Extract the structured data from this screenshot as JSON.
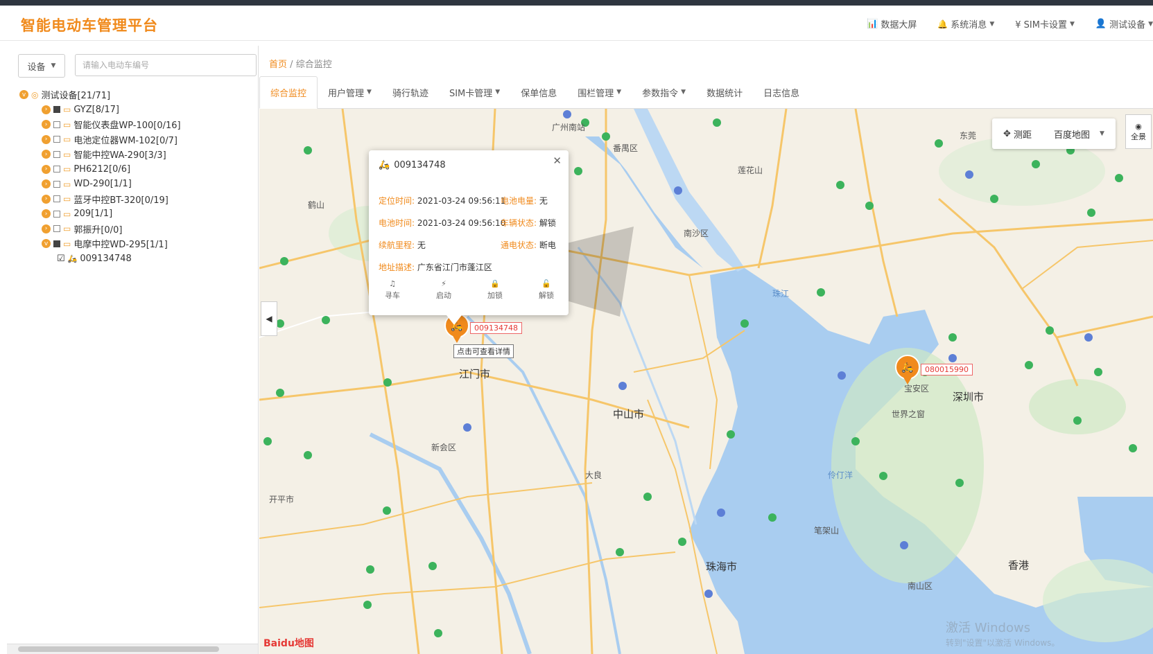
{
  "header": {
    "brand": "智能电动车管理平台",
    "nav": {
      "dashboard": "数据大屏",
      "messages": "系统消息",
      "sim": "¥ SIM卡设置",
      "user": "测试设备"
    }
  },
  "sidebar": {
    "filter_select": "设备",
    "search_placeholder": "请输入电动车编号",
    "tree": {
      "root": "测试设备[21/71]",
      "groups": [
        "GYZ[8/17]",
        "智能仪表盘WP-100[0/16]",
        "电池定位器WM-102[0/7]",
        "智能中控WA-290[3/3]",
        "PH6212[0/6]",
        "WD-290[1/1]",
        "蓝牙中控BT-320[0/19]",
        "209[1/1]",
        "郭振升[0/0]",
        "电摩中控WD-295[1/1]"
      ],
      "leaf": "009134748"
    }
  },
  "breadcrumb": {
    "home": "首页",
    "separator": "/",
    "current": "综合监控"
  },
  "tabs": [
    {
      "label": "综合监控",
      "dropdown": false
    },
    {
      "label": "用户管理",
      "dropdown": true
    },
    {
      "label": "骑行轨迹",
      "dropdown": false
    },
    {
      "label": "SIM卡管理",
      "dropdown": true
    },
    {
      "label": "保单信息",
      "dropdown": false
    },
    {
      "label": "围栏管理",
      "dropdown": true
    },
    {
      "label": "参数指令",
      "dropdown": true
    },
    {
      "label": "数据统计",
      "dropdown": false
    },
    {
      "label": "日志信息",
      "dropdown": false
    }
  ],
  "map": {
    "tools": {
      "measure": "测距",
      "map_type": "百度地图"
    },
    "fullview": "全景",
    "popup": {
      "device": "009134748",
      "fields": {
        "loc_time_label": "定位时间:",
        "loc_time": "2021-03-24 09:56:11",
        "battery_label": "电池电量:",
        "battery": "无",
        "power_time_label": "电池时间:",
        "power_time": "2021-03-24 09:56:10",
        "vehicle_status_label": "车辆状态:",
        "vehicle_status": "解锁",
        "mileage_label": "续航里程:",
        "mileage": "无",
        "power_status_label": "通电状态:",
        "power_status": "断电",
        "address_label": "地址描述:",
        "address": "广东省江门市蓬江区"
      },
      "actions": [
        "寻车",
        "启动",
        "加锁",
        "解锁"
      ]
    },
    "markers": [
      {
        "label": "009134748"
      },
      {
        "label": "080015990"
      }
    ],
    "marker_tip": "点击可查看详情",
    "places": {
      "jiangmen": "江门市",
      "zhongshan": "中山市",
      "zhuhai": "珠海市",
      "shenzhen": "深圳市",
      "hongkong": "香港",
      "nansha": "南沙区",
      "panyu": "番禺区",
      "dongguan": "东莞",
      "xinhui": "新会区",
      "heshan": "鹤山",
      "kaiping": "开平市",
      "baoan": "宝安区",
      "nanshan": "南山区",
      "lingdingyang": "伶仃洋",
      "zhujiang": "珠江",
      "lianhuashan": "莲花山",
      "daliang": "大良",
      "bijiashan": "笔架山",
      "guangzhou": "广州南站",
      "shijie": "世界之窗"
    },
    "logo": "Baidu地图",
    "watermark": "激活 Windows",
    "watermark_sub": "转到\"设置\"以激活 Windows。"
  }
}
